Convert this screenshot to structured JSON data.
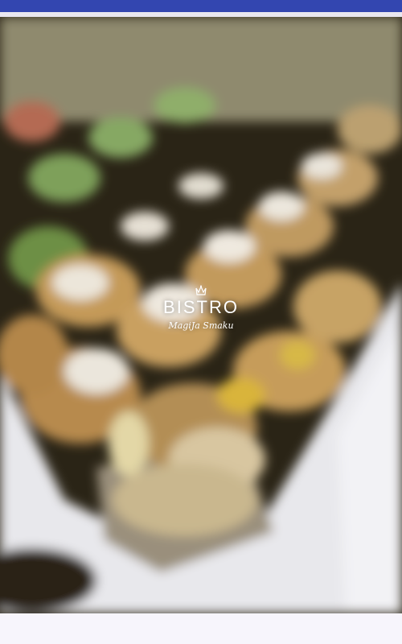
{
  "status_bar": {
    "color": "#3346b0"
  },
  "splash": {
    "background_image": "blurred-food-platter",
    "logo": {
      "icon": "crown-icon",
      "title": "BISTRO",
      "tagline": "MagiJa Smaku"
    }
  }
}
